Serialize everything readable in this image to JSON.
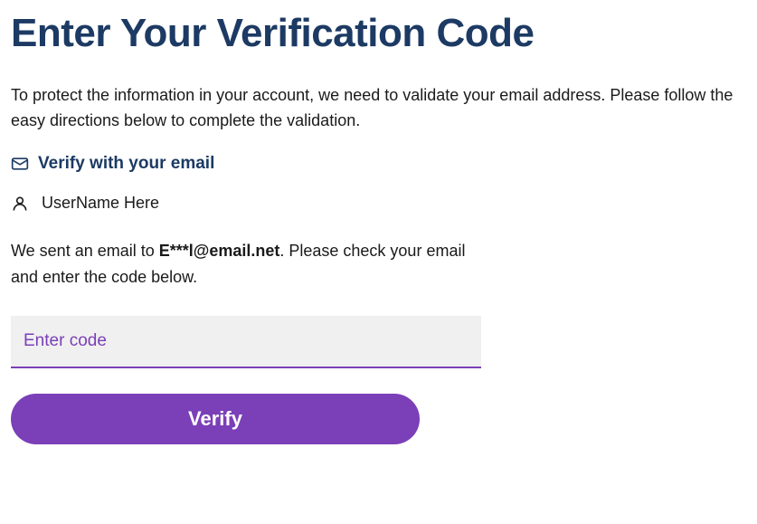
{
  "title": "Enter Your Verification Code",
  "intro": "To protect the information in your account, we need to validate your email address. Please follow the easy directions below to complete the validation.",
  "verify_method": {
    "label": "Verify with your email"
  },
  "user": {
    "name": "UserName Here"
  },
  "sent": {
    "prefix": "We sent an email to ",
    "masked_email": "E***l@email.net",
    "suffix": ". Please check your email and enter the code below."
  },
  "input": {
    "placeholder": "Enter code",
    "value": ""
  },
  "button": {
    "label": "Verify"
  }
}
